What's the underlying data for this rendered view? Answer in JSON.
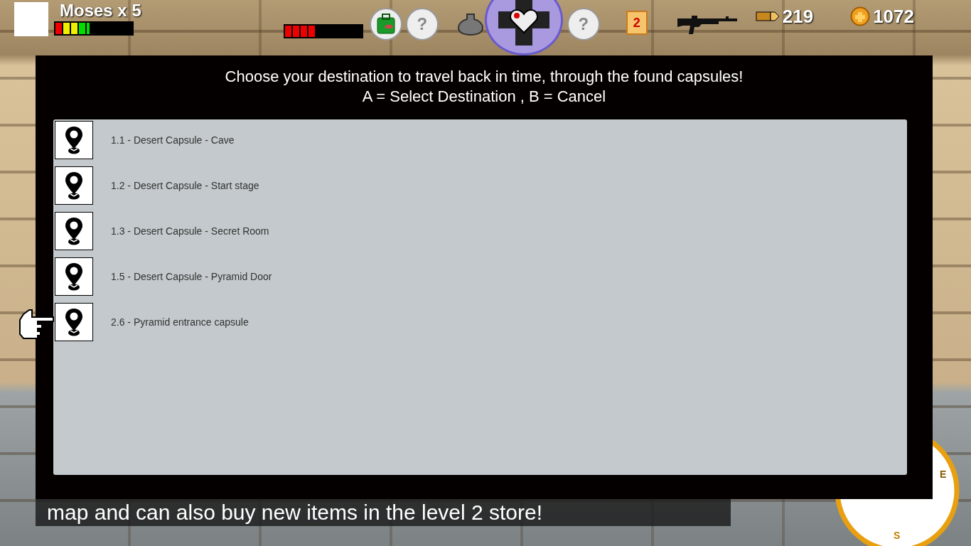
{
  "hud": {
    "player_name": "Moses x 5",
    "player_health": {
      "level": 0.45
    },
    "second_health": {
      "level": 0.4
    },
    "mystery_slots": [
      {
        "label": "?"
      },
      {
        "label": "?"
      }
    ],
    "scroll_count": "2",
    "ammo": "219",
    "coins": "1072"
  },
  "dialog": {
    "instructions": [
      "Choose your destination to travel back in time, through the found capsules!",
      "A = Select Destination , B = Cancel"
    ],
    "destinations": [
      {
        "label": "1.1 - Desert Capsule - Cave",
        "selected": false
      },
      {
        "label": "1.2 - Desert Capsule - Start stage",
        "selected": false
      },
      {
        "label": "1.3 - Desert Capsule - Secret Room",
        "selected": false
      },
      {
        "label": "1.5 - Desert Capsule - Pyramid Door",
        "selected": false
      },
      {
        "label": "2.6 - Pyramid entrance capsule",
        "selected": true
      }
    ]
  },
  "subtitle": "map and can also buy new items in the level 2 store!",
  "compass": {
    "east": "E",
    "south": "S"
  }
}
